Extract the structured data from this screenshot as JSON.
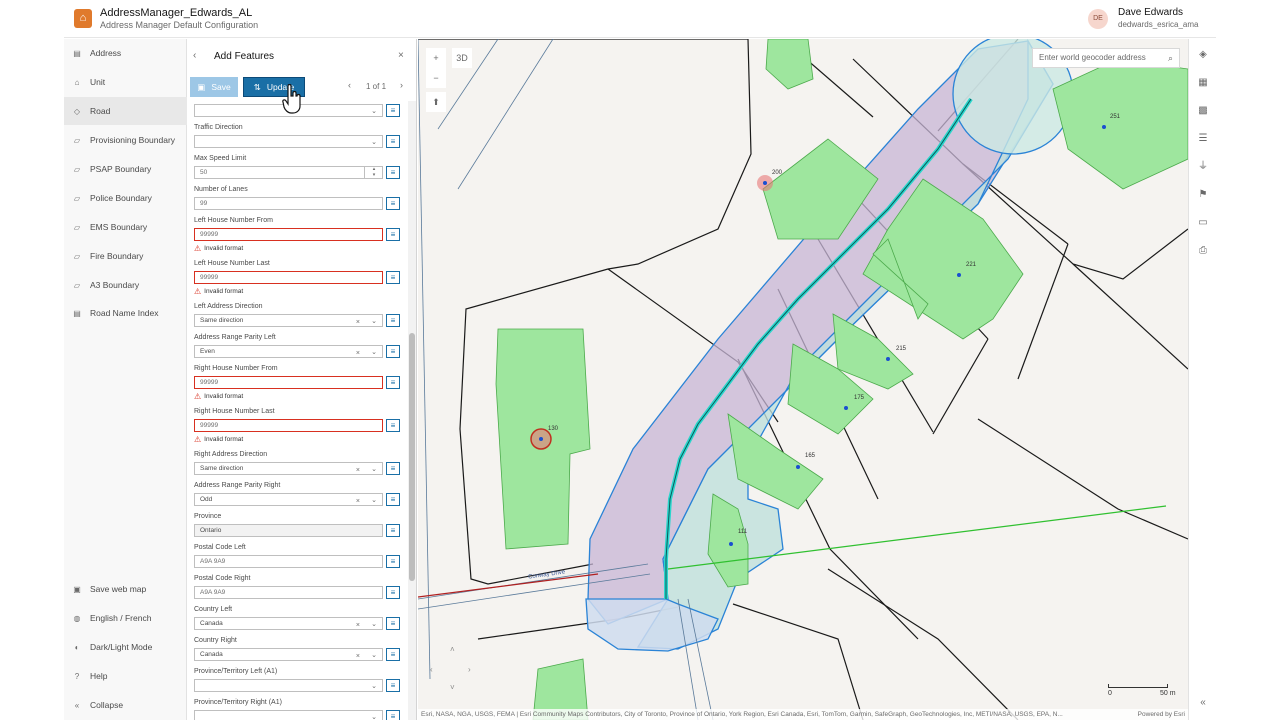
{
  "header": {
    "title": "AddressManager_Edwards_AL",
    "subtitle": "Address Manager Default Configuration",
    "avatar_initials": "DE",
    "user_name": "Dave Edwards",
    "user_handle": "dedwards_esrica_ama"
  },
  "leftnav": {
    "items": [
      {
        "label": "Address",
        "icon": "table-icon"
      },
      {
        "label": "Unit",
        "icon": "unit-icon"
      },
      {
        "label": "Road",
        "icon": "road-icon",
        "active": true
      },
      {
        "label": "Provisioning Boundary",
        "icon": "boundary-icon"
      },
      {
        "label": "PSAP Boundary",
        "icon": "boundary-icon"
      },
      {
        "label": "Police Boundary",
        "icon": "boundary-icon"
      },
      {
        "label": "EMS Boundary",
        "icon": "boundary-icon"
      },
      {
        "label": "Fire Boundary",
        "icon": "boundary-icon"
      },
      {
        "label": "A3 Boundary",
        "icon": "boundary-icon"
      },
      {
        "label": "Road Name Index",
        "icon": "table-icon"
      }
    ],
    "bottom_items": [
      {
        "label": "Save web map",
        "icon": "save-icon"
      },
      {
        "label": "English / French",
        "icon": "globe-icon"
      },
      {
        "label": "Dark/Light Mode",
        "icon": "moon-icon"
      },
      {
        "label": "Help",
        "icon": "help-icon"
      },
      {
        "label": "Collapse",
        "icon": "collapse-icon"
      }
    ]
  },
  "panel": {
    "title": "Add Features",
    "save_label": "Save",
    "update_label": "Update",
    "pager_label": "1 of 1"
  },
  "form": {
    "fields": [
      {
        "label": "",
        "value": "",
        "type": "select"
      },
      {
        "label": "Traffic Direction",
        "value": "",
        "type": "select"
      },
      {
        "label": "Max Speed Limit",
        "value": "50",
        "type": "number"
      },
      {
        "label": "Number of Lanes",
        "value": "99",
        "type": "text"
      },
      {
        "label": "Left House Number From",
        "value": "99999",
        "type": "text",
        "error": "Invalid format"
      },
      {
        "label": "Left House Number Last",
        "value": "99999",
        "type": "text",
        "error": "Invalid format"
      },
      {
        "label": "Left Address Direction",
        "value": "Same direction",
        "type": "select-clear"
      },
      {
        "label": "Address Range Parity Left",
        "value": "Even",
        "type": "select-clear"
      },
      {
        "label": "Right House Number From",
        "value": "99999",
        "type": "text",
        "error": "Invalid format"
      },
      {
        "label": "Right House Number Last",
        "value": "99999",
        "type": "text",
        "error": "Invalid format"
      },
      {
        "label": "Right Address Direction",
        "value": "Same direction",
        "type": "select-clear"
      },
      {
        "label": "Address Range Parity Right",
        "value": "Odd",
        "type": "select-clear"
      },
      {
        "label": "Province",
        "value": "Ontario",
        "type": "disabled"
      },
      {
        "label": "Postal Code Left",
        "value": "A9A 9A9",
        "type": "text"
      },
      {
        "label": "Postal Code Right",
        "value": "A9A 9A9",
        "type": "text"
      },
      {
        "label": "Country Left",
        "value": "Canada",
        "type": "select-clear"
      },
      {
        "label": "Country Right",
        "value": "Canada",
        "type": "select-clear"
      },
      {
        "label": "Province/Territory Left (A1)",
        "value": "",
        "type": "select"
      },
      {
        "label": "Province/Territory Right (A1)",
        "value": "",
        "type": "select"
      }
    ]
  },
  "map": {
    "view_3d_label": "3D",
    "search_placeholder": "Enter world geocoder address",
    "parcel_labels": [
      "251",
      "200",
      "221",
      "215",
      "175",
      "165",
      "130",
      "111"
    ],
    "scale_start": "0",
    "scale_end": "50 m",
    "attribution": "Esri, NASA, NGA, USGS, FEMA | Esri Community Maps Contributors, City of Toronto, Province of Ontario, York Region, Esri Canada, Esri, TomTom, Garmin, SafeGraph, GeoTechnologies, Inc, METI/NASA, USGS, EPA, N...",
    "powered_by": "Powered by Esri",
    "road_label": "Conway Drive"
  },
  "colors": {
    "accent": "#1a6fa6",
    "error": "#d83020",
    "building_fill": "#9ee69e",
    "road_buffer": "#b8a6c8",
    "selection": "#2a83d6"
  }
}
